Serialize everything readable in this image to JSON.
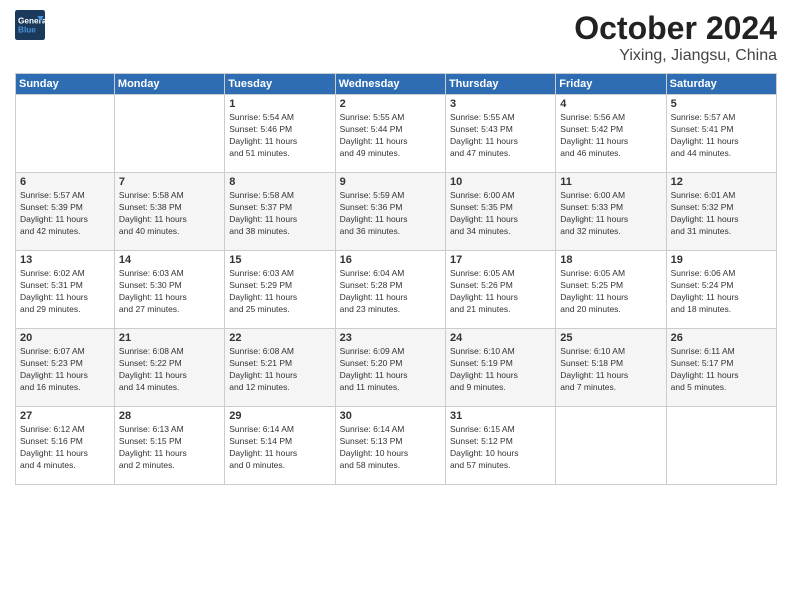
{
  "header": {
    "logo_line1": "General",
    "logo_line2": "Blue",
    "month": "October 2024",
    "location": "Yixing, Jiangsu, China"
  },
  "weekdays": [
    "Sunday",
    "Monday",
    "Tuesday",
    "Wednesday",
    "Thursday",
    "Friday",
    "Saturday"
  ],
  "weeks": [
    [
      {
        "day": "",
        "info": ""
      },
      {
        "day": "",
        "info": ""
      },
      {
        "day": "1",
        "info": "Sunrise: 5:54 AM\nSunset: 5:46 PM\nDaylight: 11 hours\nand 51 minutes."
      },
      {
        "day": "2",
        "info": "Sunrise: 5:55 AM\nSunset: 5:44 PM\nDaylight: 11 hours\nand 49 minutes."
      },
      {
        "day": "3",
        "info": "Sunrise: 5:55 AM\nSunset: 5:43 PM\nDaylight: 11 hours\nand 47 minutes."
      },
      {
        "day": "4",
        "info": "Sunrise: 5:56 AM\nSunset: 5:42 PM\nDaylight: 11 hours\nand 46 minutes."
      },
      {
        "day": "5",
        "info": "Sunrise: 5:57 AM\nSunset: 5:41 PM\nDaylight: 11 hours\nand 44 minutes."
      }
    ],
    [
      {
        "day": "6",
        "info": "Sunrise: 5:57 AM\nSunset: 5:39 PM\nDaylight: 11 hours\nand 42 minutes."
      },
      {
        "day": "7",
        "info": "Sunrise: 5:58 AM\nSunset: 5:38 PM\nDaylight: 11 hours\nand 40 minutes."
      },
      {
        "day": "8",
        "info": "Sunrise: 5:58 AM\nSunset: 5:37 PM\nDaylight: 11 hours\nand 38 minutes."
      },
      {
        "day": "9",
        "info": "Sunrise: 5:59 AM\nSunset: 5:36 PM\nDaylight: 11 hours\nand 36 minutes."
      },
      {
        "day": "10",
        "info": "Sunrise: 6:00 AM\nSunset: 5:35 PM\nDaylight: 11 hours\nand 34 minutes."
      },
      {
        "day": "11",
        "info": "Sunrise: 6:00 AM\nSunset: 5:33 PM\nDaylight: 11 hours\nand 32 minutes."
      },
      {
        "day": "12",
        "info": "Sunrise: 6:01 AM\nSunset: 5:32 PM\nDaylight: 11 hours\nand 31 minutes."
      }
    ],
    [
      {
        "day": "13",
        "info": "Sunrise: 6:02 AM\nSunset: 5:31 PM\nDaylight: 11 hours\nand 29 minutes."
      },
      {
        "day": "14",
        "info": "Sunrise: 6:03 AM\nSunset: 5:30 PM\nDaylight: 11 hours\nand 27 minutes."
      },
      {
        "day": "15",
        "info": "Sunrise: 6:03 AM\nSunset: 5:29 PM\nDaylight: 11 hours\nand 25 minutes."
      },
      {
        "day": "16",
        "info": "Sunrise: 6:04 AM\nSunset: 5:28 PM\nDaylight: 11 hours\nand 23 minutes."
      },
      {
        "day": "17",
        "info": "Sunrise: 6:05 AM\nSunset: 5:26 PM\nDaylight: 11 hours\nand 21 minutes."
      },
      {
        "day": "18",
        "info": "Sunrise: 6:05 AM\nSunset: 5:25 PM\nDaylight: 11 hours\nand 20 minutes."
      },
      {
        "day": "19",
        "info": "Sunrise: 6:06 AM\nSunset: 5:24 PM\nDaylight: 11 hours\nand 18 minutes."
      }
    ],
    [
      {
        "day": "20",
        "info": "Sunrise: 6:07 AM\nSunset: 5:23 PM\nDaylight: 11 hours\nand 16 minutes."
      },
      {
        "day": "21",
        "info": "Sunrise: 6:08 AM\nSunset: 5:22 PM\nDaylight: 11 hours\nand 14 minutes."
      },
      {
        "day": "22",
        "info": "Sunrise: 6:08 AM\nSunset: 5:21 PM\nDaylight: 11 hours\nand 12 minutes."
      },
      {
        "day": "23",
        "info": "Sunrise: 6:09 AM\nSunset: 5:20 PM\nDaylight: 11 hours\nand 11 minutes."
      },
      {
        "day": "24",
        "info": "Sunrise: 6:10 AM\nSunset: 5:19 PM\nDaylight: 11 hours\nand 9 minutes."
      },
      {
        "day": "25",
        "info": "Sunrise: 6:10 AM\nSunset: 5:18 PM\nDaylight: 11 hours\nand 7 minutes."
      },
      {
        "day": "26",
        "info": "Sunrise: 6:11 AM\nSunset: 5:17 PM\nDaylight: 11 hours\nand 5 minutes."
      }
    ],
    [
      {
        "day": "27",
        "info": "Sunrise: 6:12 AM\nSunset: 5:16 PM\nDaylight: 11 hours\nand 4 minutes."
      },
      {
        "day": "28",
        "info": "Sunrise: 6:13 AM\nSunset: 5:15 PM\nDaylight: 11 hours\nand 2 minutes."
      },
      {
        "day": "29",
        "info": "Sunrise: 6:14 AM\nSunset: 5:14 PM\nDaylight: 11 hours\nand 0 minutes."
      },
      {
        "day": "30",
        "info": "Sunrise: 6:14 AM\nSunset: 5:13 PM\nDaylight: 10 hours\nand 58 minutes."
      },
      {
        "day": "31",
        "info": "Sunrise: 6:15 AM\nSunset: 5:12 PM\nDaylight: 10 hours\nand 57 minutes."
      },
      {
        "day": "",
        "info": ""
      },
      {
        "day": "",
        "info": ""
      }
    ]
  ]
}
